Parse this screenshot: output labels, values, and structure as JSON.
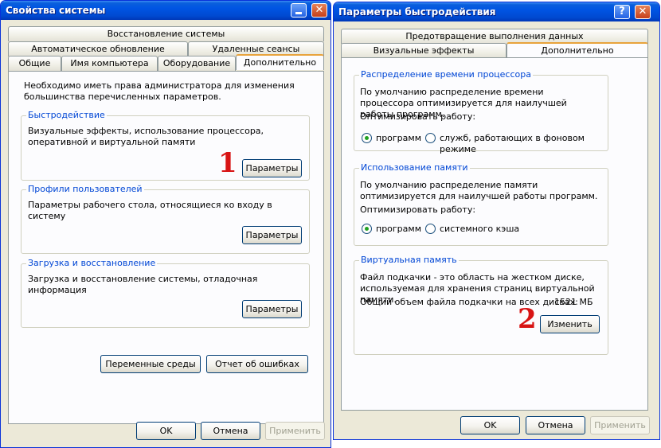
{
  "left_window": {
    "title": "Свойства системы",
    "tabs_row1": [
      "Восстановление системы"
    ],
    "tabs_row2": [
      "Автоматическое обновление",
      "Удаленные сеансы"
    ],
    "tabs_row3": [
      "Общие",
      "Имя компьютера",
      "Оборудование",
      "Дополнительно"
    ],
    "intro": "Необходимо иметь права администратора для изменения большинства перечисленных параметров.",
    "performance": {
      "title": "Быстродействие",
      "text": "Визуальные эффекты, использование процессора, оперативной и виртуальной памяти",
      "button": "Параметры"
    },
    "profiles": {
      "title": "Профили пользователей",
      "text": "Параметры рабочего стола, относящиеся ко входу в систему",
      "button": "Параметры"
    },
    "startup": {
      "title": "Загрузка и восстановление",
      "text": "Загрузка и восстановление системы, отладочная информация",
      "button": "Параметры"
    },
    "env_button": "Переменные среды",
    "error_button": "Отчет об ошибках",
    "ok": "OK",
    "cancel": "Отмена",
    "apply": "Применить"
  },
  "right_window": {
    "title": "Параметры быстродействия",
    "help_glyph": "?",
    "close_glyph": "✕",
    "tabs_row1": [
      "Предотвращение выполнения данных"
    ],
    "tabs_row2": [
      "Визуальные эффекты",
      "Дополнительно"
    ],
    "cpu": {
      "title": "Распределение времени процессора",
      "text": "По умолчанию распределение времени процессора оптимизируется для наилучшей работы программ.",
      "optimize_label": "Оптимизировать работу:",
      "option_programs": "программ",
      "option_services": "служб, работающих в фоновом режиме",
      "selected": "программ"
    },
    "memory": {
      "title": "Использование памяти",
      "text": "По умолчанию распределение памяти оптимизируется для наилучшей работы программ.",
      "optimize_label": "Оптимизировать работу:",
      "option_programs": "программ",
      "option_cache": "системного кэша",
      "selected": "программ"
    },
    "virtual": {
      "title": "Виртуальная память",
      "text": "Файл подкачки - это область на жестком диске, используемая для хранения страниц виртуальной памяти.",
      "total_label": "Общий объем файла подкачки на всех дисках:",
      "total_value": "1521 МБ",
      "change_button": "Изменить"
    },
    "ok": "OK",
    "cancel": "Отмена",
    "apply": "Применить"
  },
  "markers": {
    "one": "1",
    "two": "2"
  },
  "colors": {
    "titlebar": "#0054e3",
    "group_title": "#0046d5",
    "active_tab_accent": "#e8a33c",
    "marker": "#d81414"
  }
}
